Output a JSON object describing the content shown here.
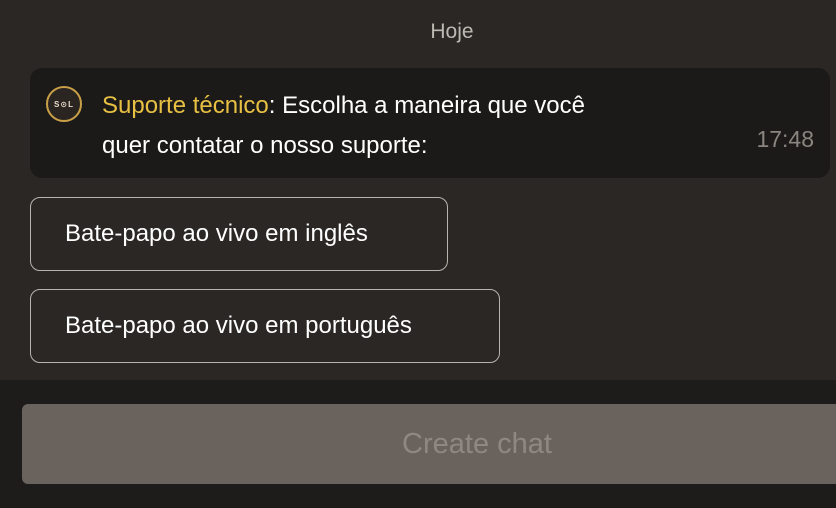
{
  "chat": {
    "date_divider": "Hoje",
    "message": {
      "avatar_text": "S⊙L",
      "sender": "Suporte técnico",
      "separator": ": ",
      "text_line1": "Escolha a maneira que você",
      "text_line2": "quer contatar o nosso suporte:",
      "time": "17:48"
    },
    "options": [
      {
        "label": "Bate-papo ao vivo em inglês"
      },
      {
        "label": "Bate-papo ao vivo em português"
      }
    ]
  },
  "footer": {
    "create_chat_label": "Create chat"
  },
  "colors": {
    "background": "#2a2724",
    "bubble": "#1c1a18",
    "sender_accent": "#e7c043",
    "footer": "#1e1c1a",
    "button_disabled": "#6a625c"
  }
}
